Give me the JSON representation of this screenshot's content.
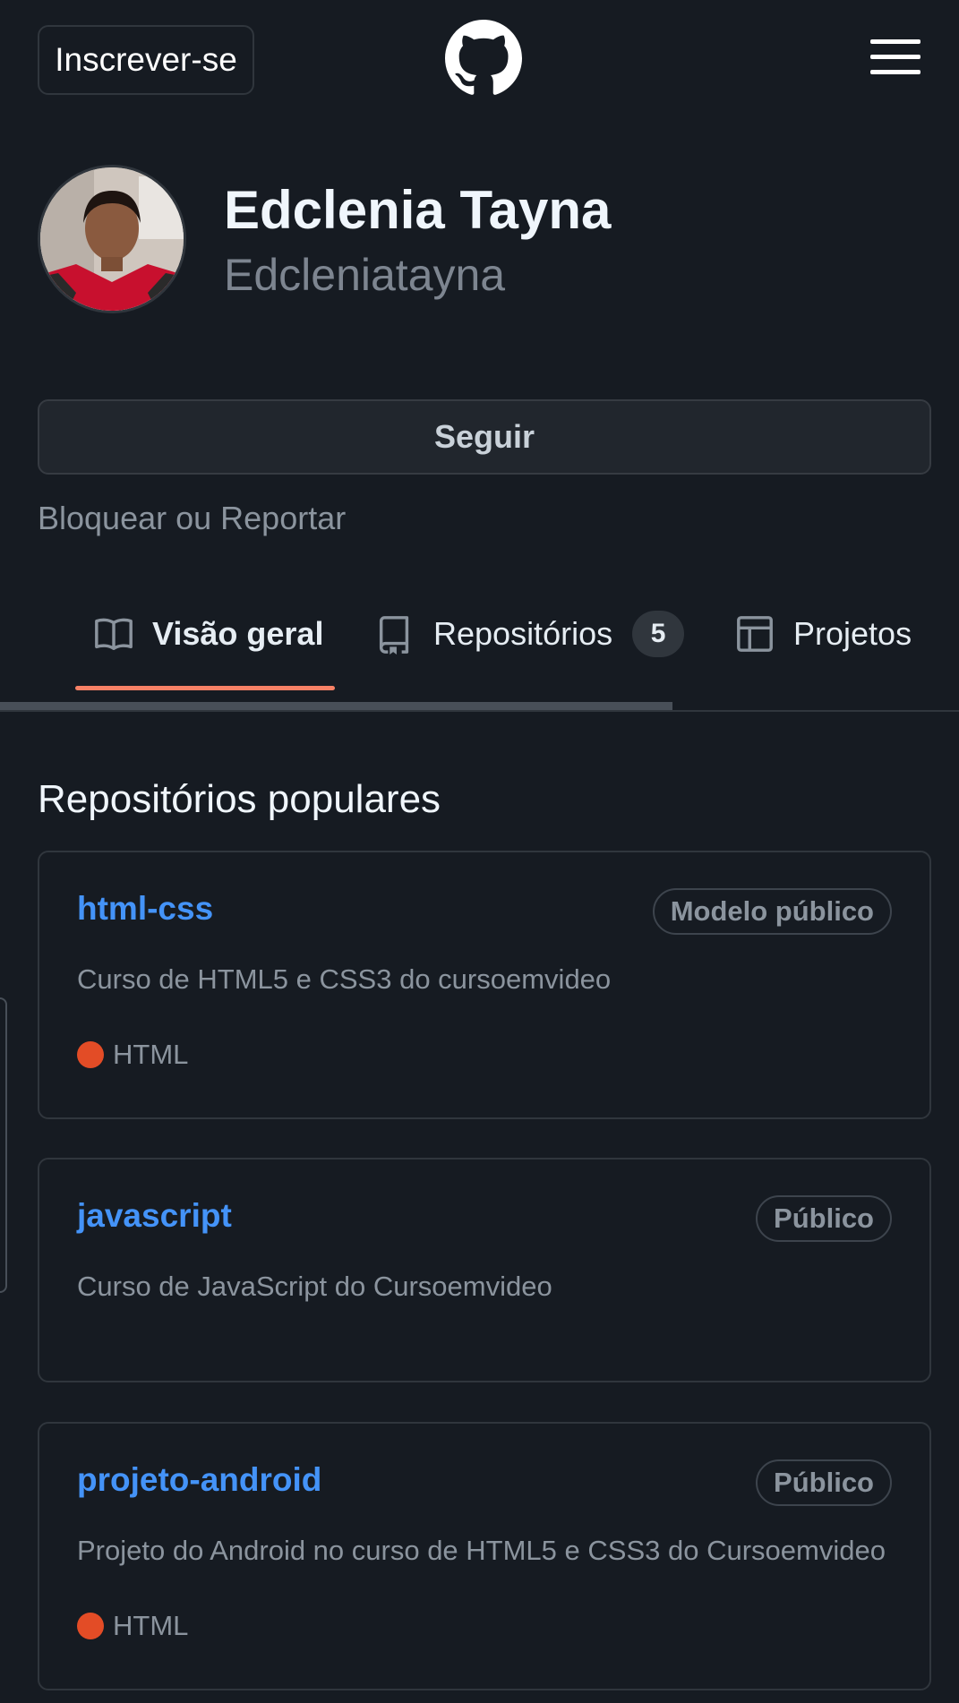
{
  "header": {
    "signup_label": "Inscrever-se",
    "logo_icon": "github-octocat-icon",
    "menu_icon": "hamburger-menu-icon"
  },
  "profile": {
    "name": "Edclenia Tayna",
    "login": "Edcleniatayna",
    "avatar_icon": "user-avatar-photo",
    "follow_label": "Seguir",
    "block_label": "Bloquear ou Reportar"
  },
  "tabs": [
    {
      "label": "Visão geral",
      "icon": "book-icon",
      "selected": true
    },
    {
      "label": "Repositórios",
      "icon": "repo-icon",
      "count": "5"
    },
    {
      "label": "Projetos",
      "icon": "table-icon"
    }
  ],
  "popular": {
    "title": "Repositórios populares",
    "repos": [
      {
        "name": "html-css",
        "visibility": "Modelo público",
        "description": "Curso de HTML5 e CSS3 do cursoemvideo",
        "language": "HTML",
        "language_color": "#e34c26"
      },
      {
        "name": "javascript",
        "visibility": "Público",
        "description": "Curso de JavaScript do Cursoemvideo"
      },
      {
        "name": "projeto-android",
        "visibility": "Público",
        "description": "Projeto do Android no curso de HTML5 e CSS3 do Cursoemvideo",
        "language": "HTML",
        "language_color": "#e34c26"
      }
    ]
  },
  "colors": {
    "background": "#161b22",
    "link": "#4493f8",
    "tab_underline": "#f78166",
    "border": "#30363d"
  }
}
